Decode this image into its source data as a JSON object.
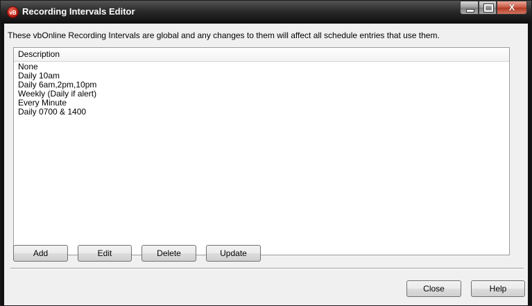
{
  "window": {
    "title": "Recording Intervals Editor",
    "app_icon_text": "vB",
    "close_glyph": "X"
  },
  "info_text": "These vbOnline Recording Intervals are global and any changes to them will affect all schedule entries that use them.",
  "list": {
    "header": "Description",
    "items": [
      "None",
      "Daily 10am",
      "Daily 6am,2pm,10pm",
      "Weekly (Daily if alert)",
      "Every Minute",
      "Daily 0700 & 1400"
    ]
  },
  "buttons": {
    "add": "Add",
    "edit": "Edit",
    "delete": "Delete",
    "update": "Update",
    "close": "Close",
    "help": "Help"
  },
  "colors": {
    "title_bar": "#1b1b1b",
    "close_button": "#c8543f",
    "dialog_background": "#f0f0f0"
  }
}
